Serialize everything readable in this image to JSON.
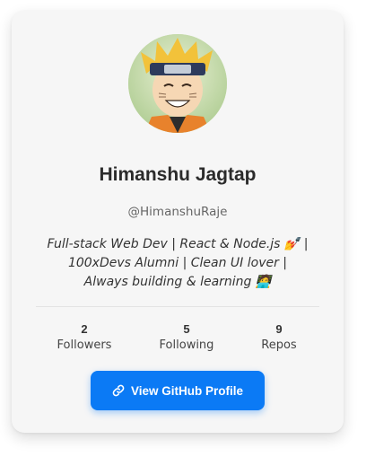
{
  "profile": {
    "name": "Himanshu Jagtap",
    "username": "@HimanshuRaje",
    "bio": "Full-stack Web Dev | React & Node.js 💅 | 100xDevs Alumni | Clean UI lover | Always building & learning 🧑‍💻",
    "avatar_icon": "anime-character-avatar"
  },
  "stats": [
    {
      "value": "2",
      "label": "Followers"
    },
    {
      "value": "5",
      "label": "Following"
    },
    {
      "value": "9",
      "label": "Repos"
    }
  ],
  "button": {
    "label": "View GitHub Profile",
    "icon": "link-icon",
    "color": "#0b7af5"
  }
}
